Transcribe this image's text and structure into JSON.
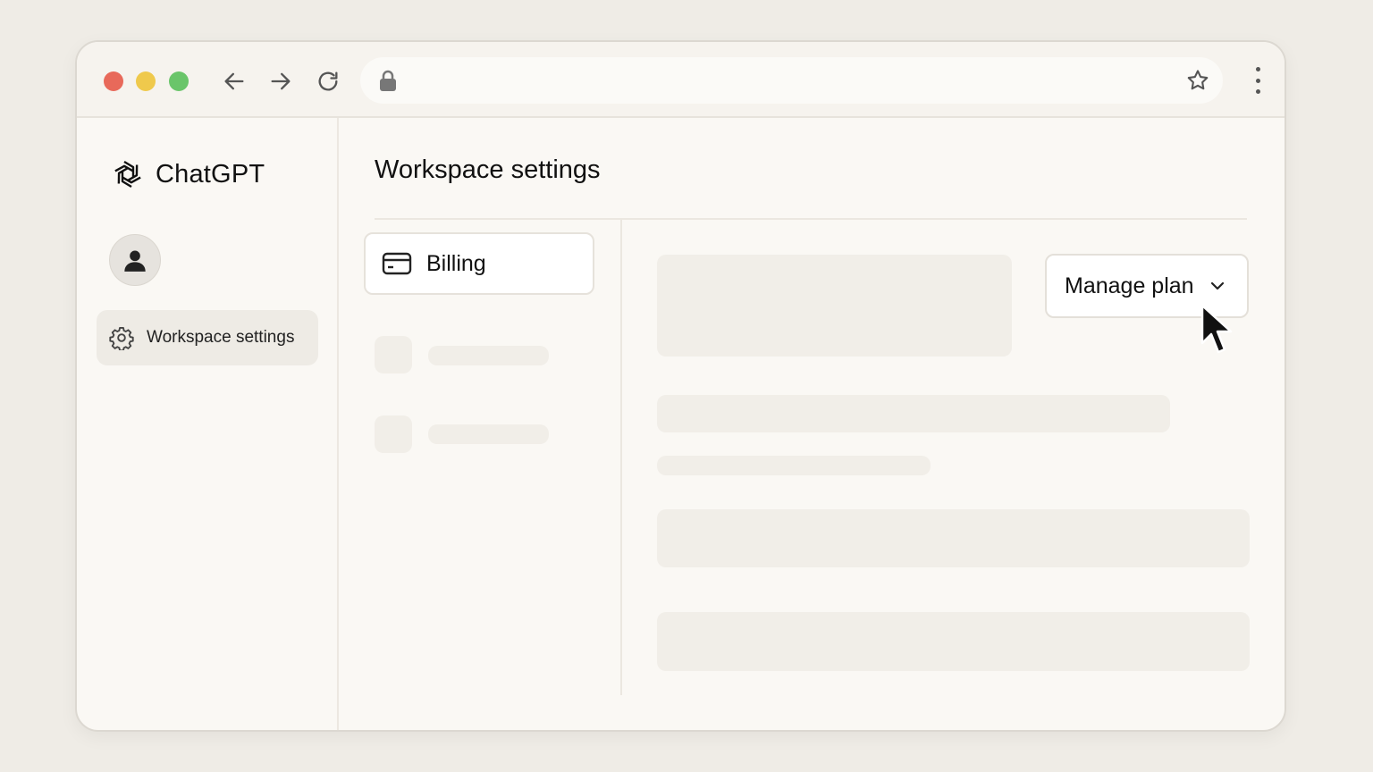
{
  "browser": {
    "icons": {
      "back": "arrow-left-icon",
      "forward": "arrow-right-icon",
      "reload": "reload-icon",
      "lock": "lock-icon",
      "bookmark": "star-icon",
      "menu": "kebab-menu-icon"
    },
    "address_text": ""
  },
  "sidebar": {
    "brand": "ChatGPT",
    "items": [
      {
        "label": "Workspace settings",
        "icon": "gear-icon",
        "selected": true
      }
    ]
  },
  "main": {
    "title": "Workspace settings",
    "tabs": [
      {
        "label": "Billing",
        "icon": "credit-card-icon",
        "selected": true
      }
    ],
    "manage_button": {
      "label": "Manage plan",
      "icon": "chevron-down-icon"
    }
  },
  "colors": {
    "background": "#efece6",
    "window": "#faf8f4",
    "placeholder": "#f1eee8",
    "traffic_red": "#e8695a",
    "traffic_yellow": "#efc94c",
    "traffic_green": "#6ac56a"
  }
}
